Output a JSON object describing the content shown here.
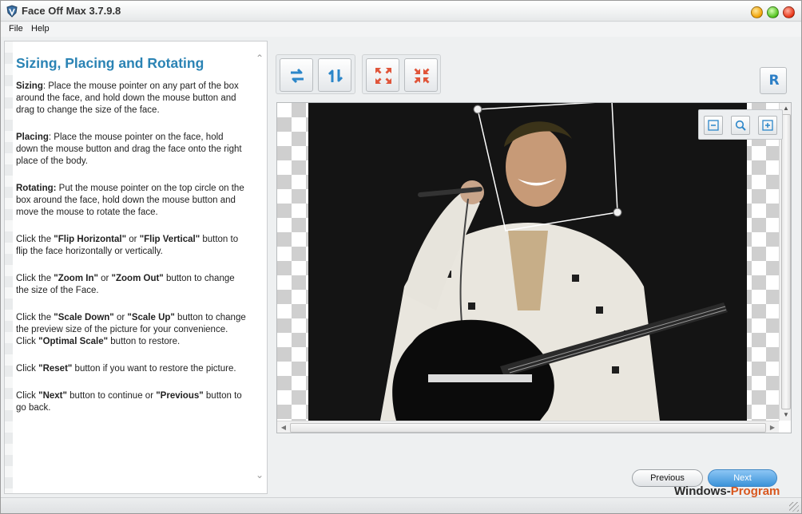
{
  "window": {
    "title": "Face Off Max  3.7.9.8"
  },
  "menu": {
    "file": "File",
    "help": "Help"
  },
  "help": {
    "title": "Sizing, Placing and Rotating",
    "p1_label": "Sizing",
    "p1_text": ": Place the mouse pointer on any part of the box around the face, and hold down the mouse button and drag to change the size of the face.",
    "p2_label": "Placing",
    "p2_text": ": Place the mouse pointer on the face, hold down the mouse button and drag the face onto the right place of the body.",
    "p3_label": "Rotating:",
    "p3_text": " Put the mouse pointer on the top circle on the box around the face, hold down the mouse button and move the mouse to rotate the face.",
    "p4_a": "Click the ",
    "p4_b": "\"Flip Horizontal\"",
    "p4_c": " or ",
    "p4_d": "\"Flip Vertical\"",
    "p4_e": " button to flip the face horizontally or vertically.",
    "p5_a": "Click the ",
    "p5_b": "\"Zoom In\"",
    "p5_c": " or ",
    "p5_d": "\"Zoom Out\"",
    "p5_e": " button to change the size of the Face.",
    "p6_a": "Click the ",
    "p6_b": "\"Scale Down\"",
    "p6_c": " or ",
    "p6_d": "\"Scale Up\"",
    "p6_e": " button to change the preview size of the picture for your convenience. Click ",
    "p6_f": "\"Optimal Scale\"",
    "p6_g": " button to restore.",
    "p7_a": "Click ",
    "p7_b": "\"Reset\"",
    "p7_c": " button if you want to restore the picture.",
    "p8_a": "Click ",
    "p8_b": "\"Next\"",
    "p8_c": " button to continue or ",
    "p8_d": "\"Previous\"",
    "p8_e": " button to go back."
  },
  "toolbar": {
    "flip_horizontal_icon": "flip-horizontal-icon",
    "flip_vertical_icon": "flip-vertical-icon",
    "zoom_in_face_icon": "expand-arrows-icon",
    "zoom_out_face_icon": "collapse-arrows-icon",
    "reset_label": "R"
  },
  "nav": {
    "previous": "Previous",
    "next": "Next"
  },
  "brand": {
    "windows": "Windows-",
    "program": "Program"
  },
  "colors": {
    "accent_title": "#2a83b4",
    "next_button": "#3b93d9",
    "brand_orange": "#d8571e"
  }
}
